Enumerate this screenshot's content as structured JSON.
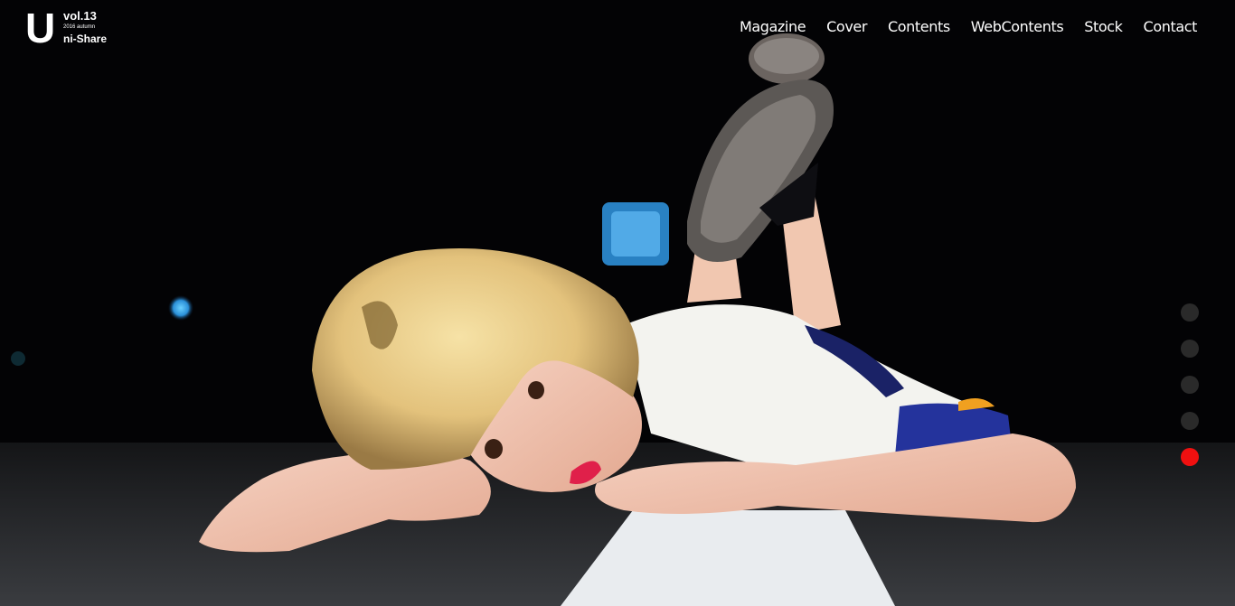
{
  "logo": {
    "letter": "U",
    "volume": "vol.13",
    "season": "2016 autumn",
    "name": "ni-Share"
  },
  "nav": {
    "items": [
      {
        "label": "Magazine"
      },
      {
        "label": "Cover"
      },
      {
        "label": "Contents"
      },
      {
        "label": "WebContents"
      },
      {
        "label": "Stock"
      },
      {
        "label": "Contact"
      }
    ]
  },
  "slider": {
    "dot_count": 5,
    "active_index": 4,
    "active_color": "#f01010",
    "inactive_color": "#2a2a2a"
  },
  "hero": {
    "image": "photo-woman-lying-on-road-at-night"
  }
}
